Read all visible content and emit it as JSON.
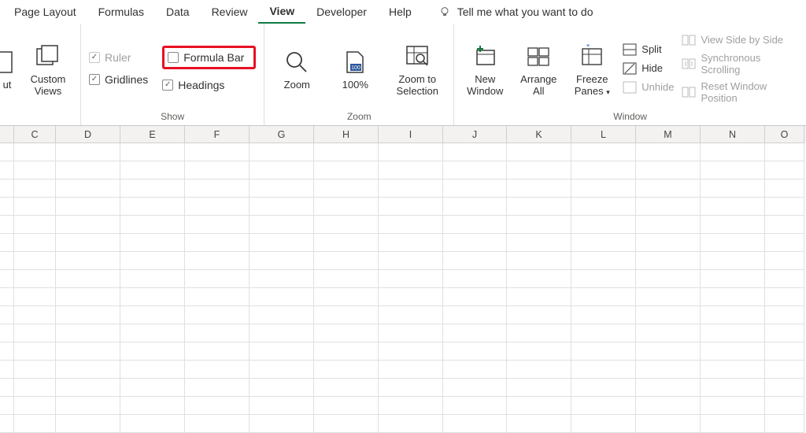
{
  "tabs": {
    "page_layout": "Page Layout",
    "formulas": "Formulas",
    "data": "Data",
    "review": "Review",
    "view": "View",
    "developer": "Developer",
    "help": "Help"
  },
  "tell_me": "Tell me what you want to do",
  "ribbon": {
    "views": {
      "layout_label_line1": "ut",
      "custom_views": "Custom\nViews"
    },
    "show": {
      "ruler": "Ruler",
      "formula_bar": "Formula Bar",
      "gridlines": "Gridlines",
      "headings": "Headings",
      "group_label": "Show"
    },
    "zoom": {
      "zoom": "Zoom",
      "hundred": "100%",
      "zoom_to_selection": "Zoom to\nSelection",
      "group_label": "Zoom"
    },
    "window": {
      "new_window": "New\nWindow",
      "arrange_all": "Arrange\nAll",
      "freeze_panes": "Freeze\nPanes",
      "split": "Split",
      "hide": "Hide",
      "unhide": "Unhide",
      "side_by_side": "View Side by Side",
      "sync_scroll": "Synchronous Scrolling",
      "reset_pos": "Reset Window Position",
      "group_label": "Window"
    }
  },
  "columns": [
    "C",
    "D",
    "E",
    "F",
    "G",
    "H",
    "I",
    "J",
    "K",
    "L",
    "M",
    "N",
    "O"
  ]
}
